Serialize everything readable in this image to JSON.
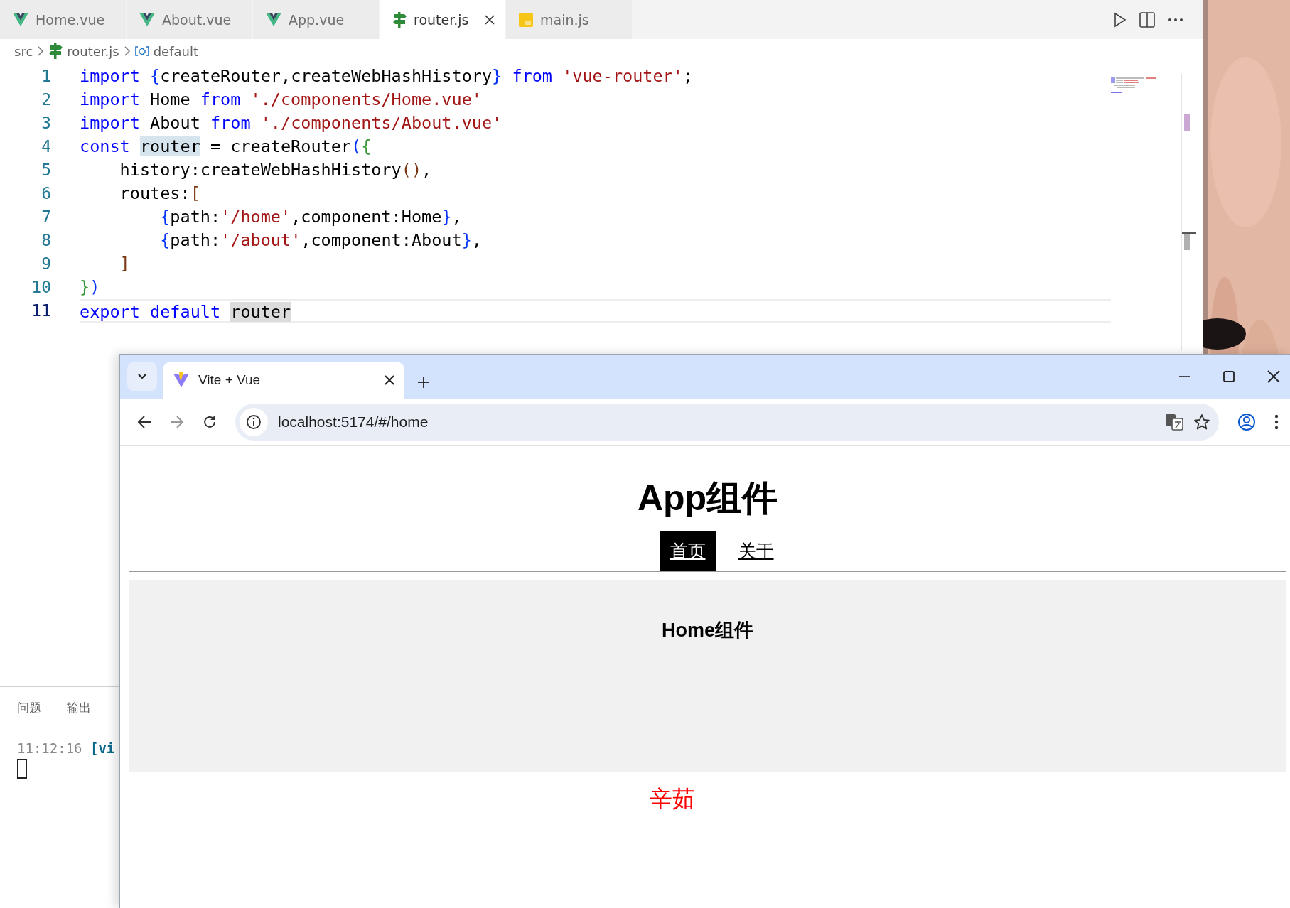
{
  "editor_tabs": [
    {
      "label": "Home.vue",
      "kind": "vue",
      "selected": false
    },
    {
      "label": "About.vue",
      "kind": "vue",
      "selected": false
    },
    {
      "label": "App.vue",
      "kind": "vue",
      "selected": false
    },
    {
      "label": "router.js",
      "kind": "router",
      "selected": true
    },
    {
      "label": "main.js",
      "kind": "js",
      "selected": false
    }
  ],
  "breadcrumb": [
    "src",
    "router.js",
    "default"
  ],
  "code_lines": [
    {
      "number": "1",
      "current": false,
      "tokens": [
        {
          "kind": "keyword",
          "text": "import "
        },
        {
          "kind": "bracket1",
          "text": "{"
        },
        {
          "kind": "plain",
          "text": "createRouter,createWebHashHistory"
        },
        {
          "kind": "bracket1",
          "text": "} "
        },
        {
          "kind": "keyword",
          "text": "from "
        },
        {
          "kind": "string",
          "text": "'vue-router'"
        },
        {
          "kind": "plain",
          "text": ";"
        }
      ]
    },
    {
      "number": "2",
      "current": false,
      "tokens": [
        {
          "kind": "keyword",
          "text": "import"
        },
        {
          "kind": "plain",
          "text": " Home "
        },
        {
          "kind": "keyword",
          "text": "from "
        },
        {
          "kind": "string",
          "text": "'./components/Home.vue'"
        }
      ]
    },
    {
      "number": "3",
      "current": false,
      "tokens": [
        {
          "kind": "keyword",
          "text": "import"
        },
        {
          "kind": "plain",
          "text": " About "
        },
        {
          "kind": "keyword",
          "text": "from "
        },
        {
          "kind": "string",
          "text": "'./components/About.vue'"
        }
      ]
    },
    {
      "number": "4",
      "current": false,
      "tokens": [
        {
          "kind": "keyword",
          "text": "const "
        },
        {
          "kind": "occurrence",
          "text": "router"
        },
        {
          "kind": "plain",
          "text": " = createRouter"
        },
        {
          "kind": "bracket1",
          "text": "("
        },
        {
          "kind": "bracket2",
          "text": "{"
        }
      ]
    },
    {
      "number": "5",
      "current": false,
      "tokens": [
        {
          "kind": "plain",
          "text": "    history:createWebHashHistory"
        },
        {
          "kind": "bracket3",
          "text": "()"
        },
        {
          "kind": "plain",
          "text": ","
        }
      ]
    },
    {
      "number": "6",
      "current": false,
      "tokens": [
        {
          "kind": "plain",
          "text": "    routes:"
        },
        {
          "kind": "bracket3",
          "text": "["
        }
      ]
    },
    {
      "number": "7",
      "current": false,
      "tokens": [
        {
          "kind": "bracket1",
          "text": "        {"
        },
        {
          "kind": "plain",
          "text": "path:"
        },
        {
          "kind": "string",
          "text": "'/home'"
        },
        {
          "kind": "plain",
          "text": ",component:Home"
        },
        {
          "kind": "bracket1",
          "text": "}"
        },
        {
          "kind": "plain",
          "text": ","
        }
      ]
    },
    {
      "number": "8",
      "current": false,
      "tokens": [
        {
          "kind": "bracket1",
          "text": "        {"
        },
        {
          "kind": "plain",
          "text": "path:"
        },
        {
          "kind": "string",
          "text": "'/about'"
        },
        {
          "kind": "plain",
          "text": ",component:About"
        },
        {
          "kind": "bracket1",
          "text": "}"
        },
        {
          "kind": "plain",
          "text": ","
        }
      ]
    },
    {
      "number": "9",
      "current": false,
      "tokens": [
        {
          "kind": "bracket3",
          "text": "    ]"
        }
      ]
    },
    {
      "number": "10",
      "current": false,
      "tokens": [
        {
          "kind": "bracket2",
          "text": "}"
        },
        {
          "kind": "bracket1",
          "text": ")"
        }
      ]
    },
    {
      "number": "11",
      "current": true,
      "tokens": [
        {
          "kind": "keyword",
          "text": "export default "
        },
        {
          "kind": "selection",
          "text": "router"
        }
      ]
    }
  ],
  "panel": {
    "tabs": [
      "问题",
      "输出"
    ],
    "terminal_time": "11:12:16",
    "terminal_text": "[vi"
  },
  "browser": {
    "tab_title": "Vite + Vue",
    "url": "localhost:5174/#/home",
    "page": {
      "heading": "App组件",
      "nav": [
        {
          "label": "首页",
          "selected": true
        },
        {
          "label": "关于",
          "selected": false
        }
      ],
      "view_heading": "Home组件",
      "footer_text": "辛茹"
    }
  }
}
